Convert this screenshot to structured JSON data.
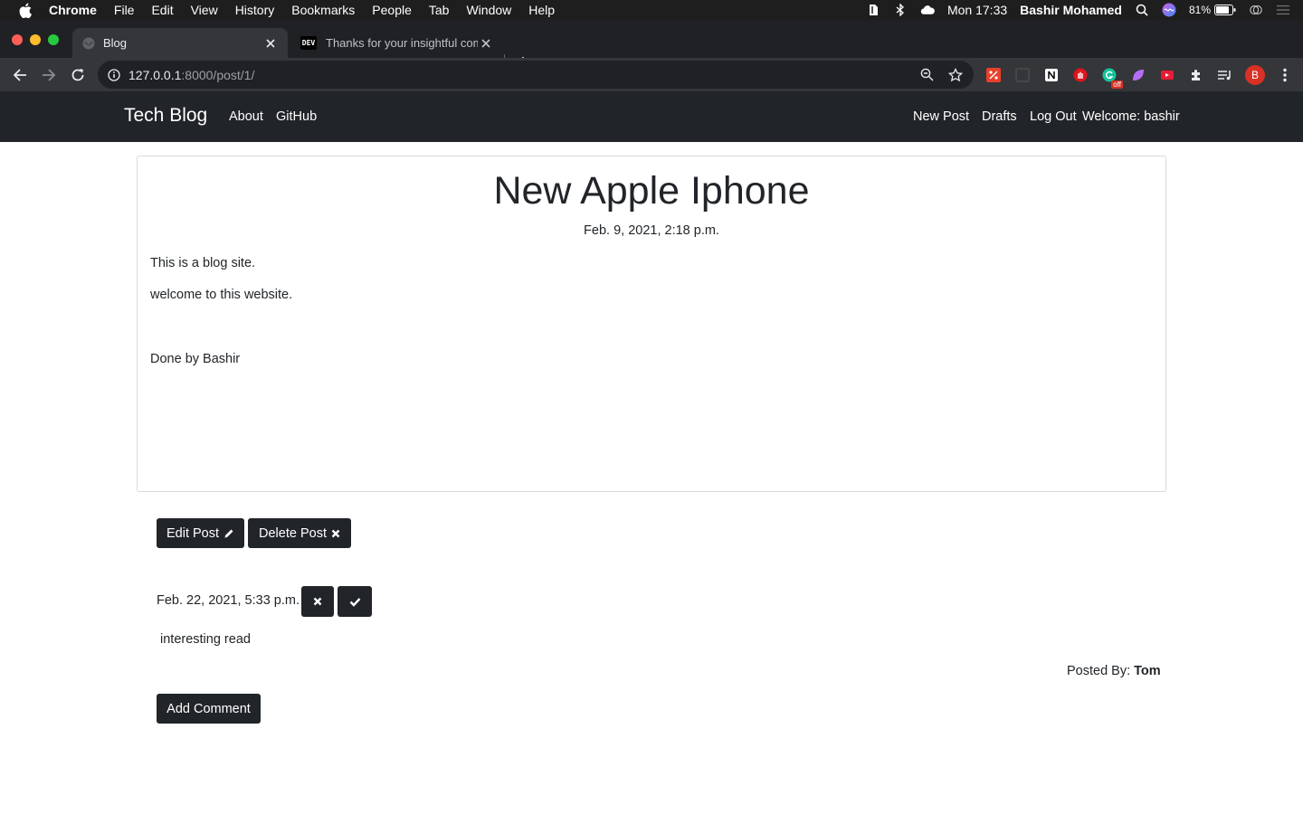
{
  "menubar": {
    "app_name": "Chrome",
    "items": [
      "File",
      "Edit",
      "View",
      "History",
      "Bookmarks",
      "People",
      "Tab",
      "Window",
      "Help"
    ],
    "battery": "81%",
    "clock": "Mon 17:33",
    "user": "Bashir Mohamed"
  },
  "browser": {
    "tabs": [
      {
        "title": "Blog",
        "active": true
      },
      {
        "title": "Thanks for your insightful comm",
        "active": false,
        "favicon_text": "DEV"
      }
    ],
    "url_host": "127.0.0.1",
    "url_rest": ":8000/post/1/",
    "profile_initial": "B",
    "ext_badge": "off"
  },
  "site": {
    "brand": "Tech Blog",
    "nav_left": [
      "About",
      "GitHub"
    ],
    "nav_right": [
      "New Post",
      "Drafts",
      "Log Out",
      "Welcome: bashir"
    ]
  },
  "post": {
    "title": "New Apple Iphone",
    "date": "Feb. 9, 2021, 2:18 p.m.",
    "body": [
      "This is a blog site.",
      "welcome to this website.",
      "Done by Bashir"
    ],
    "edit_label": "Edit Post",
    "delete_label": "Delete Post"
  },
  "comment": {
    "date": "Feb. 22, 2021, 5:33 p.m.",
    "text": "interesting read",
    "posted_by_label": "Posted By:",
    "author": "Tom"
  },
  "add_comment_label": "Add Comment",
  "colors": {
    "navbar_bg": "#212529",
    "button_bg": "#212529",
    "chrome_tabstrip": "#202124",
    "chrome_toolbar": "#35363a"
  }
}
